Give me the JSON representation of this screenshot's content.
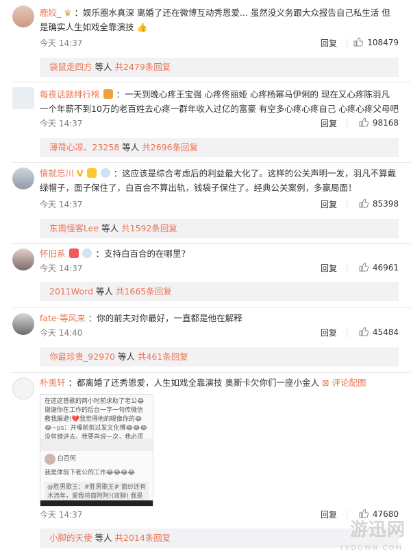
{
  "reply_label": "回复",
  "others_label": "等人",
  "comments": [
    {
      "username": "鹿姣_",
      "text": "：娱乐圈水真深 离婚了还在微博互动秀恩爱... 虽然没义务跟大众报告自己私生活 但是确实人生如戏全靠演技",
      "emoji": "👍",
      "time": "今天 14:37",
      "likes": "108479",
      "sub_user": "袋鼠走四方",
      "sub_count": "共2479条回复"
    },
    {
      "username": "每夜话题排行榜",
      "text": "：一天到晚心疼王宝强 心疼佟丽娅 心疼杨幂马伊俐的 现在又心疼陈羽凡 一个年薪不到10万的老百姓去心疼一群年收入过亿的富豪 有空多心疼心疼自己 心疼心疼父母吧",
      "time": "今天 14:37",
      "likes": "98168",
      "sub_user": "薄荷心凉、23258",
      "sub_count": "共2696条回复"
    },
    {
      "username": "情就忘川",
      "text": "：这应该是综合考虑后的利益最大化了。这样的公关声明一发，羽凡不算戴绿帽子，面子保住了，白百合不算出轨，钱袋子保住了。经典公关案例，多赢局面！",
      "time": "今天 14:37",
      "likes": "85398",
      "sub_user": "东南怪客Lee",
      "sub_count": "共1592条回复"
    },
    {
      "username": "怀旧系",
      "text": "：支持白百合的在哪里？",
      "time": "今天 14:37",
      "likes": "46961",
      "sub_user": "2011Word",
      "sub_count": "共1665条回复"
    },
    {
      "username": "fate-等风来",
      "text": "：你的前夫对你最好，一直都是他在解释",
      "time": "今天 14:40",
      "likes": "45484",
      "sub_user": "你最珍贵_92970",
      "sub_count": "共461条回复"
    },
    {
      "username": "朴兎轩",
      "text": "：都离婚了还秀恩爱，人生如戏全靠演技 奥斯卡欠你们一座小金人",
      "pic_label": "评论配图",
      "time": "今天 14:37",
      "likes": "47680",
      "sub_user": "小脚的天使",
      "sub_count": "共2014条回复"
    }
  ],
  "thumb_top": "在这这首歌的两小时前求助了老公😂谢谢你在工作的后台一字一句传微信教我躲避!💔我觉得他的眼像你的😂😂~ps：开嗓前剪过发文化傅😂😂😂没剪镜进去。我要再说一次，我必须再说一次，你是我心中的嗨歌大神!@陈羽凡 66666谢谢你辅助我当了一把MVP😂😂😂",
  "thumb_bottom_user": "白百何",
  "thumb_bottom_text": "我是体验下老公的工作😂😂😂😂",
  "thumb_bottom_sub": "@胜男歌王：#胜男歌王# 面纱还有水流年，爱我将面阿阿!(双脚) 我是胜男@白百何 昨天21:08 为你喝歌!",
  "watermark": "游迅网",
  "watermark_sub": "YXDOWN.COM"
}
